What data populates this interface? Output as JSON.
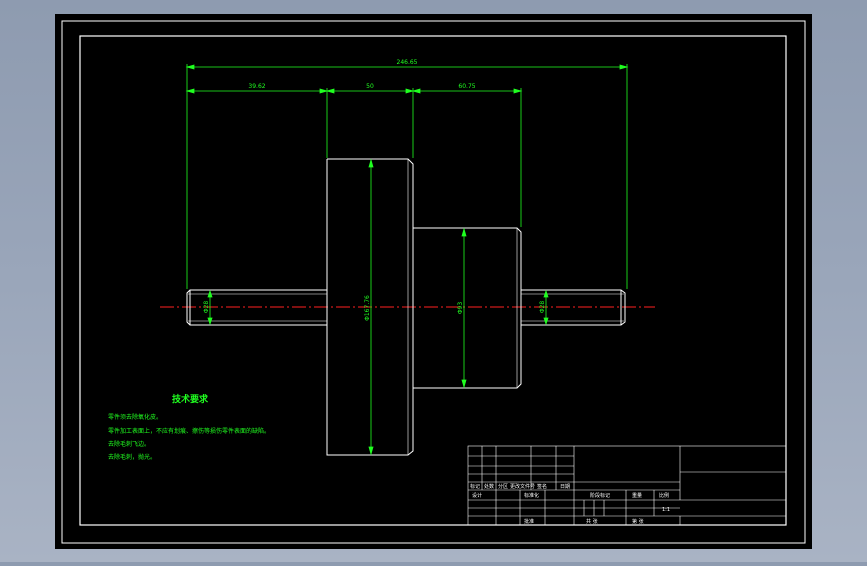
{
  "drawing": {
    "dimensions": {
      "overall_length": "246.65",
      "left_shaft_length": "39.62",
      "flange_length": "50",
      "hub_length": "60.75",
      "left_shaft_dia": "Φ28",
      "flange_dia": "Φ167.76",
      "hub_dia": "Φ93",
      "right_shaft_dia": "Φ28"
    },
    "notes": {
      "title": "技术要求",
      "items": [
        "零件须去除氧化皮。",
        "零件加工表面上，不应有划痕、擦伤等损伤零件表面的缺陷。",
        "去除毛刺飞边。",
        "去除毛刺，抛光。"
      ]
    },
    "title_block": {
      "row_labels": [
        "标记",
        "处数",
        "分区",
        "更改文件号",
        "签名",
        "日期"
      ],
      "design_label": "设计",
      "standardize_label": "标准化",
      "stage_label": "阶段标记",
      "weight_label": "重量",
      "scale_label": "比例",
      "scale_value": "1:1",
      "sheet_total_label": "共  张",
      "sheet_label": "第  张",
      "approve_label": "批准"
    },
    "colors": {
      "outline": "#ffffff",
      "dimension": "#20ff20",
      "centerline": "#ff2020",
      "paper": "#000000"
    }
  }
}
